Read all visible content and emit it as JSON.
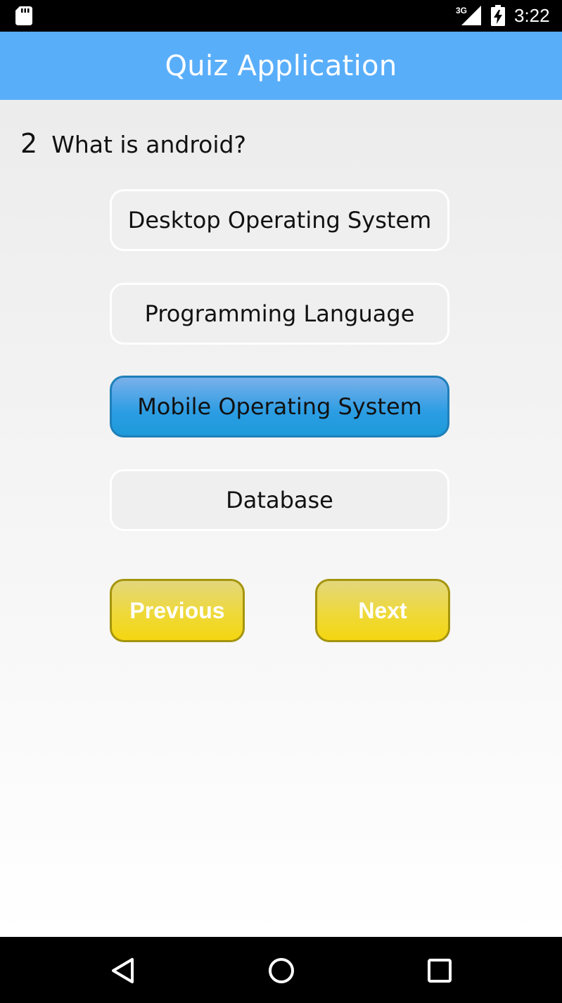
{
  "status_bar": {
    "time": "3:22",
    "network_label": "3G",
    "icons": [
      "sd-card-icon",
      "signal-3g-icon",
      "battery-charging-icon"
    ]
  },
  "app_bar": {
    "title": "Quiz Application",
    "color": "#59aefa"
  },
  "question": {
    "number": "2",
    "text": "What is android?"
  },
  "options": [
    {
      "label": "Desktop Operating System",
      "selected": false
    },
    {
      "label": "Programming Language",
      "selected": false
    },
    {
      "label": "Mobile Operating System",
      "selected": true
    },
    {
      "label": "Database",
      "selected": false
    }
  ],
  "buttons": {
    "previous": "Previous",
    "next": "Next"
  },
  "navigation_bar": {
    "icons": [
      "back-icon",
      "home-icon",
      "recents-icon"
    ]
  },
  "colors": {
    "selected_option": "#2b9de3",
    "nav_button": "#f5d611"
  }
}
